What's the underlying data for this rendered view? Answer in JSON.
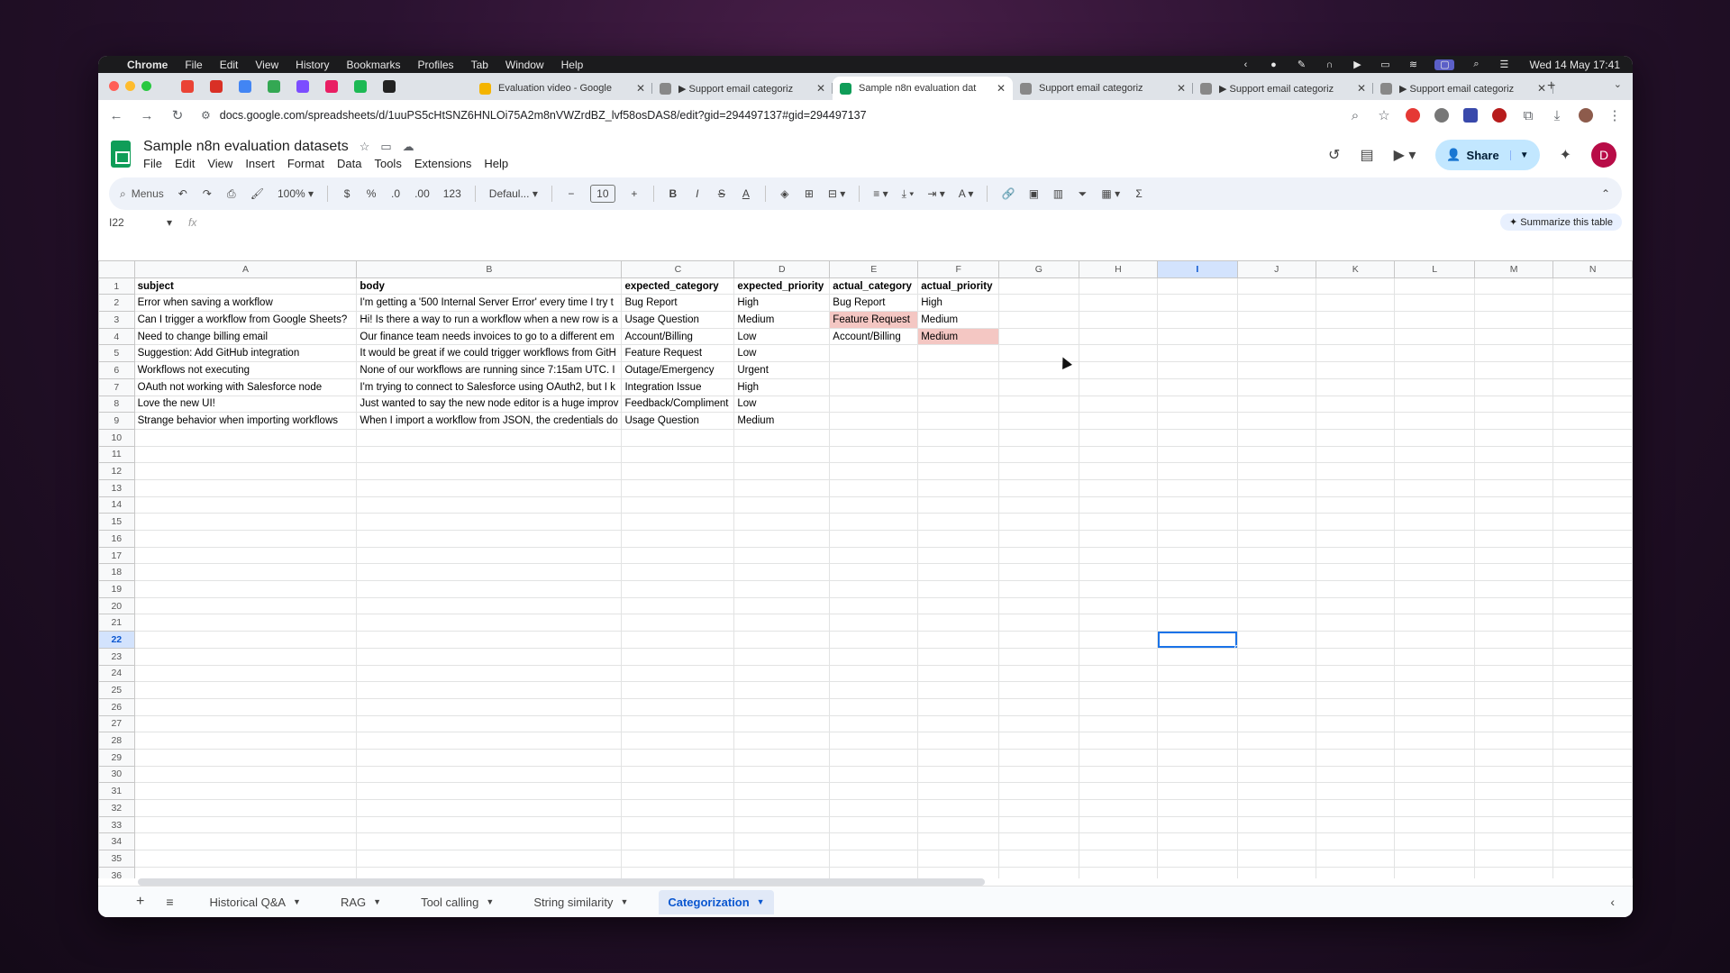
{
  "menubar": {
    "app": "Chrome",
    "items": [
      "File",
      "Edit",
      "View",
      "History",
      "Bookmarks",
      "Profiles",
      "Tab",
      "Window",
      "Help"
    ],
    "clock": "Wed 14 May  17:41"
  },
  "tabs": [
    {
      "title": "Evaluation video - Google",
      "favicon_color": "#f4b400"
    },
    {
      "title": "▶ Support email categoriz",
      "favicon_color": "#888888"
    },
    {
      "title": "Sample n8n evaluation dat",
      "favicon_color": "#0f9d58",
      "active": true
    },
    {
      "title": "Support email categoriz",
      "favicon_color": "#888888"
    },
    {
      "title": "▶ Support email categoriz",
      "favicon_color": "#888888"
    },
    {
      "title": "▶ Support email categoriz",
      "favicon_color": "#888888"
    }
  ],
  "address": {
    "url": "docs.google.com/spreadsheets/d/1uuPS5cHtSNZ6HNLOi75A2m8nVWZrdBZ_lvf58osDAS8/edit?gid=294497137#gid=294497137"
  },
  "doc": {
    "title": "Sample n8n evaluation datasets",
    "menu": [
      "File",
      "Edit",
      "View",
      "Insert",
      "Format",
      "Data",
      "Tools",
      "Extensions",
      "Help"
    ],
    "share_label": "Share",
    "avatar_letter": "D"
  },
  "toolbar": {
    "menus_label": "Menus",
    "zoom": "100%",
    "currency": "$",
    "percent": "%",
    "dec_decrease": ".0",
    "dec_increase": ".00",
    "number_format": "123",
    "font": "Defaul...",
    "font_size": "10"
  },
  "formula": {
    "cell_ref": "I22",
    "fx": "fx",
    "summarize_label": "Summarize this table"
  },
  "grid": {
    "columns": [
      "A",
      "B",
      "C",
      "D",
      "E",
      "F",
      "G",
      "H",
      "I",
      "J",
      "K",
      "L",
      "M",
      "N"
    ],
    "selected_column": "I",
    "selected_row": 22,
    "rows": [
      [
        "subject",
        "body",
        "expected_category",
        "expected_priority",
        "actual_category",
        "actual_priority"
      ],
      [
        "Error when saving a workflow",
        "I'm getting a '500 Internal Server Error' every time I try t",
        "Bug Report",
        "High",
        "Bug Report",
        "High"
      ],
      [
        "Can I trigger a workflow from Google Sheets?",
        "Hi! Is there a way to run a workflow when a new row is a",
        "Usage Question",
        "Medium",
        "Feature Request",
        "Medium"
      ],
      [
        "Need to change billing email",
        "Our finance team needs invoices to go to a different em",
        "Account/Billing",
        "Low",
        "Account/Billing",
        "Medium"
      ],
      [
        "Suggestion: Add GitHub integration",
        "It would be great if we could trigger workflows from GitH",
        "Feature Request",
        "Low",
        "",
        ""
      ],
      [
        "Workflows not executing",
        "None of our workflows are running since 7:15am UTC. I",
        "Outage/Emergency",
        "Urgent",
        "",
        ""
      ],
      [
        "OAuth not working with Salesforce node",
        "I'm trying to connect to Salesforce using OAuth2, but I k",
        "Integration Issue",
        "High",
        "",
        ""
      ],
      [
        "Love the new UI!",
        "Just wanted to say the new node editor is a huge improv",
        "Feedback/Compliment",
        "Low",
        "",
        ""
      ],
      [
        "Strange behavior when importing workflows",
        "When I import a workflow from JSON, the credentials do",
        "Usage Question",
        "Medium",
        "",
        ""
      ]
    ],
    "highlight_color": "#f4c7c3",
    "total_rows": 36
  },
  "sheets": {
    "tabs": [
      "Historical Q&A",
      "RAG",
      "Tool calling",
      "String similarity",
      "Categorization"
    ],
    "active": "Categorization"
  }
}
